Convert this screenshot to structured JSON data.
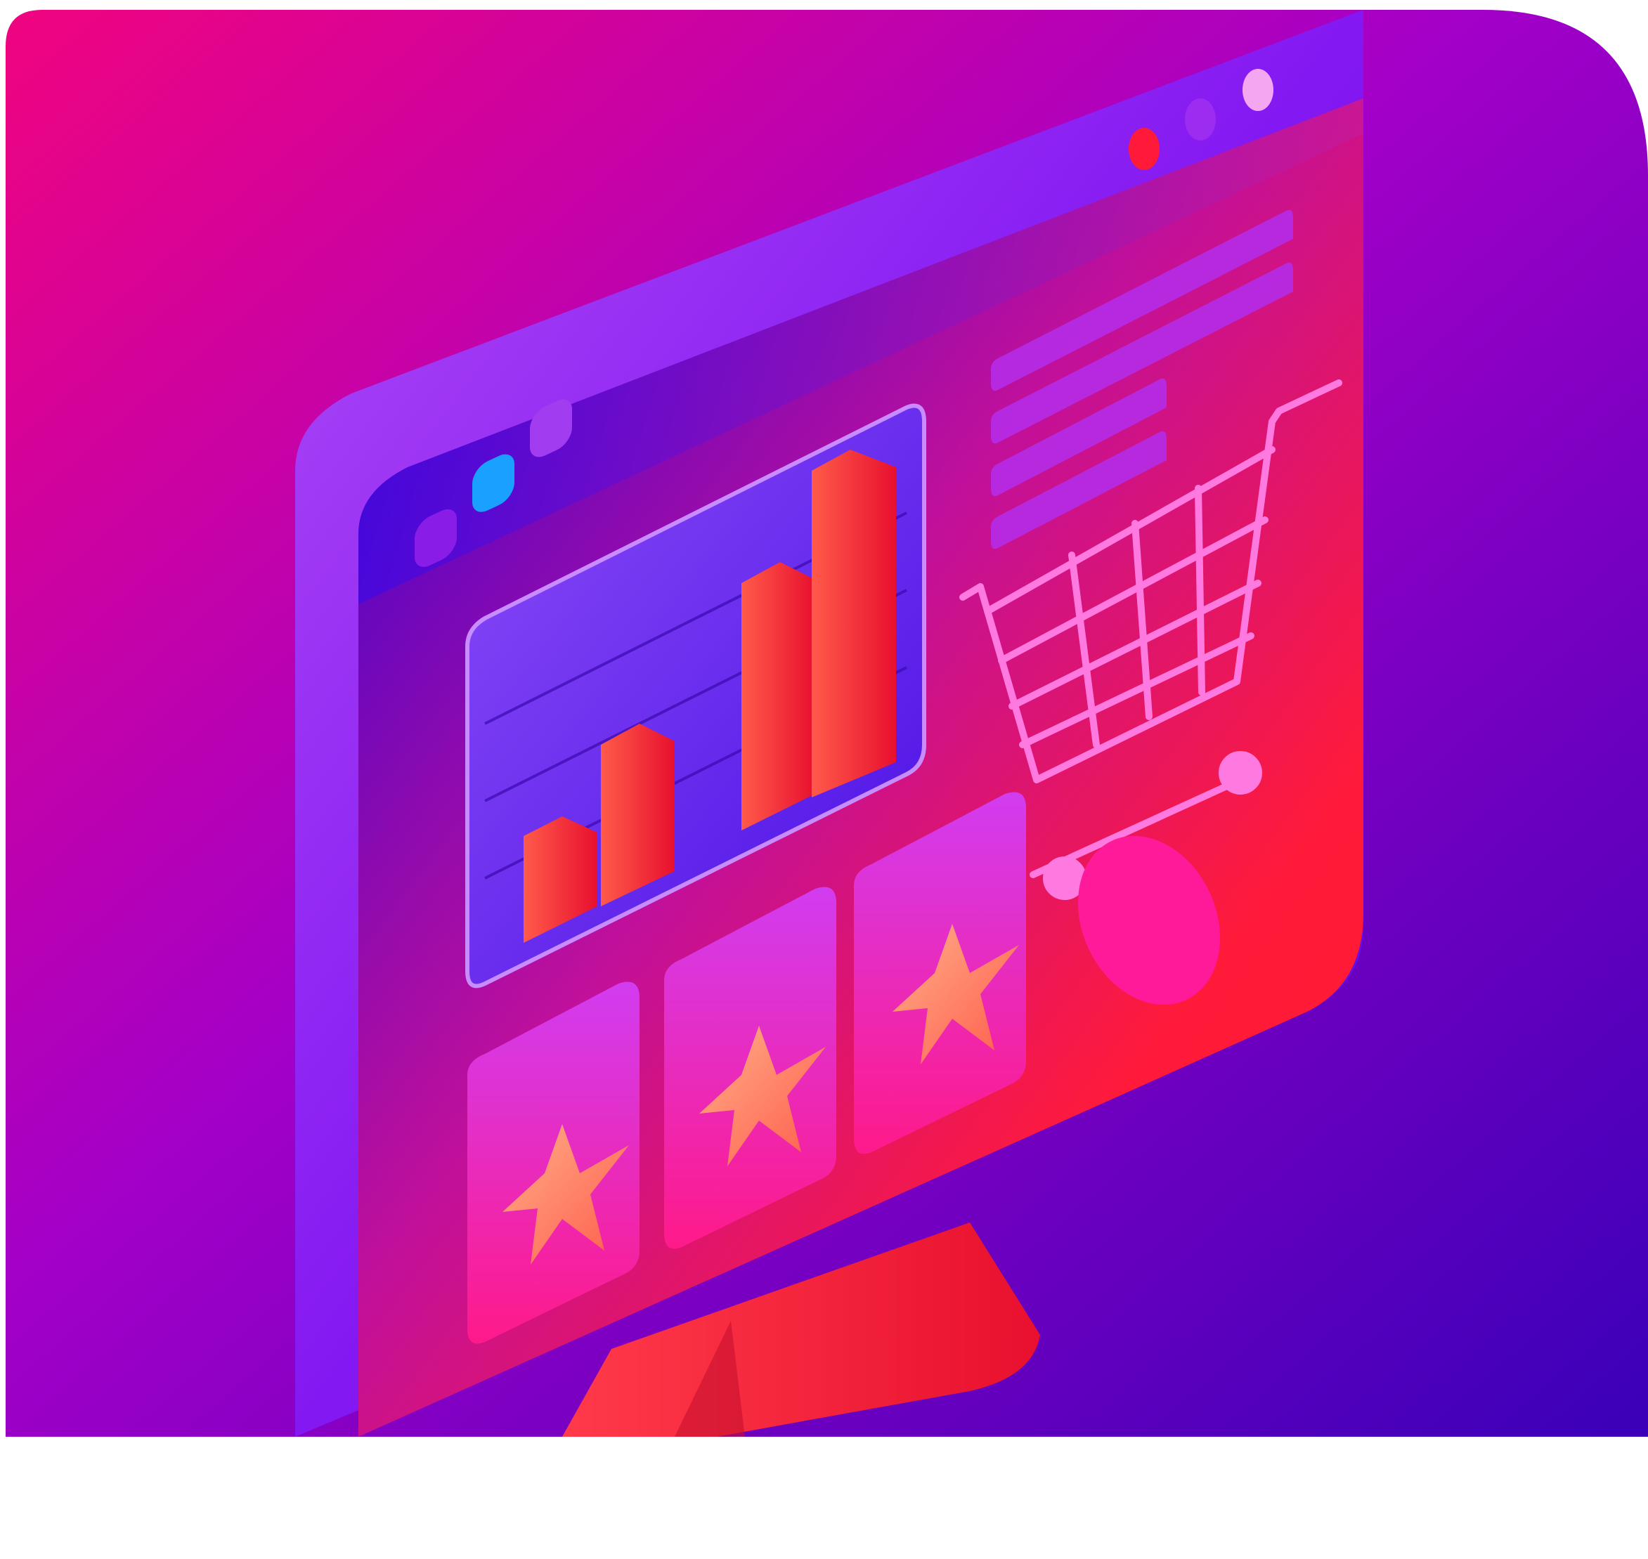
{
  "colors": {
    "background_start": "#f0047f",
    "background_mid": "#a300c8",
    "background_end": "#3a00b8",
    "monitor_frame": "#7a12f0",
    "screen_start": "#2a00d8",
    "screen_end": "#ff1a2e",
    "bar_color": "#ff2a3a",
    "cart_color": "#ff6ad8",
    "star_color": "#ff7a55",
    "window_dot_red": "#ff1a3a",
    "window_dot_purple": "#9b2cf0",
    "window_dot_pink": "#f4a6f0",
    "tab_dot_purple": "#8a1ce8",
    "tab_dot_cyan": "#1aa0ff",
    "tab_dot_violet": "#a23cf0"
  },
  "icons": [
    "monitor-icon",
    "bar-chart-icon",
    "shopping-cart-icon",
    "star-icon",
    "window-dots-icon",
    "text-lines-icon"
  ],
  "rating": {
    "stars_shown": 3
  },
  "chart_bars_relative_heights": [
    0.3,
    0.55,
    0.78,
    1.0
  ]
}
